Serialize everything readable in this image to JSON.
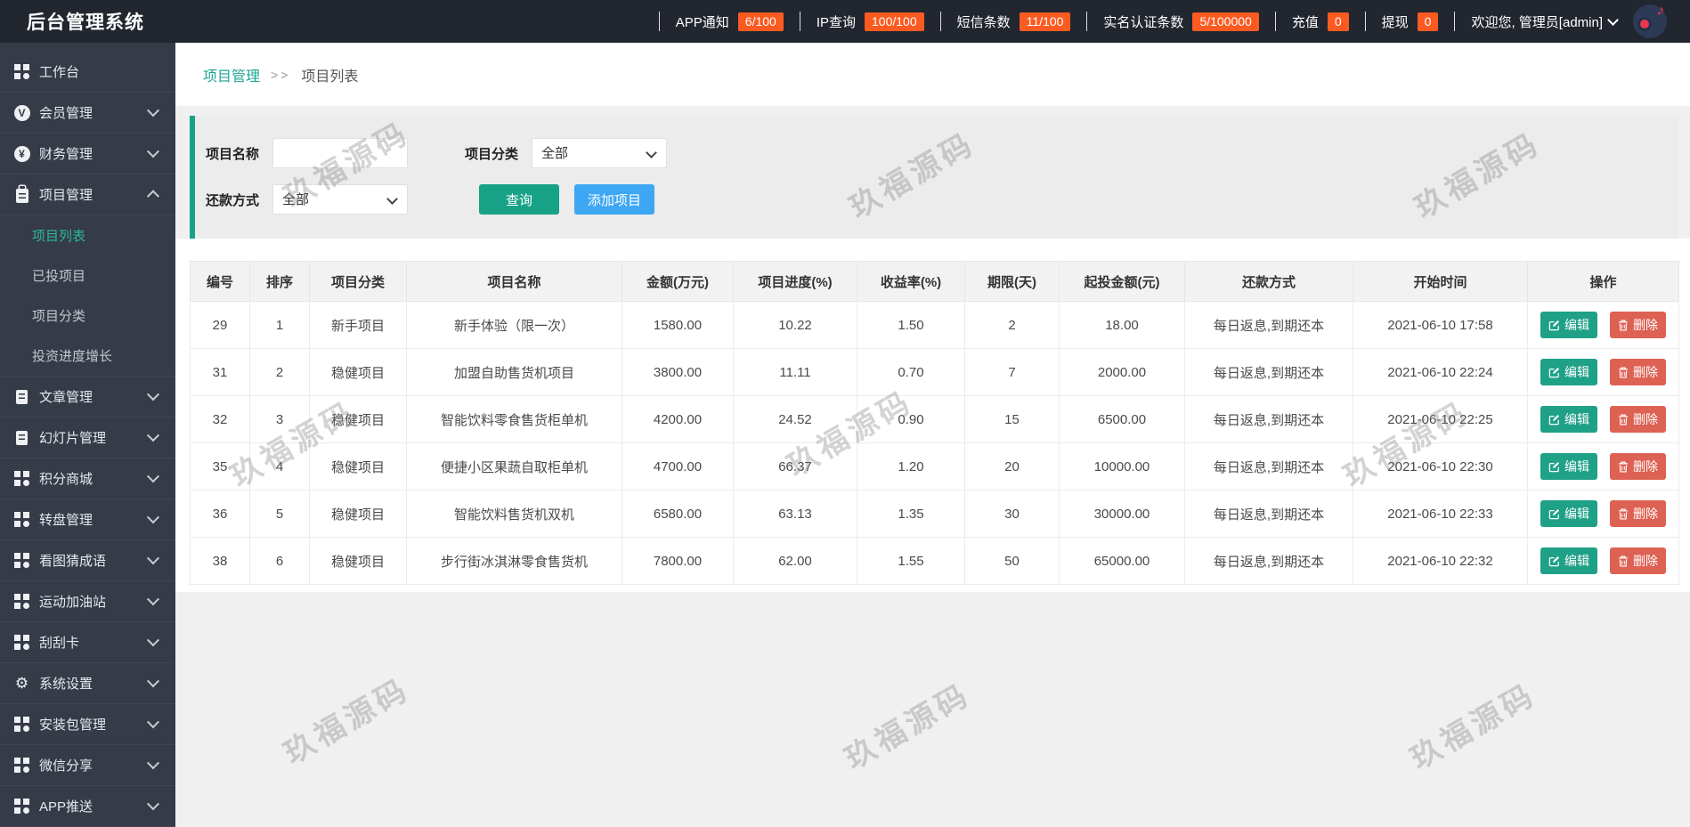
{
  "app": {
    "title": "后台管理系统"
  },
  "topbar": {
    "stats": [
      {
        "label": "APP通知",
        "badge": "6/100"
      },
      {
        "label": "IP查询",
        "badge": "100/100"
      },
      {
        "label": "短信条数",
        "badge": "11/100"
      },
      {
        "label": "实名认证条数",
        "badge": "5/100000"
      },
      {
        "label": "充值",
        "badge": "0"
      },
      {
        "label": "提现",
        "badge": "0"
      }
    ],
    "welcome_text": "欢迎您, 管理员[admin]",
    "badge_color": "#fb5b21"
  },
  "sidebar": {
    "items": [
      {
        "label": "工作台",
        "icon": "grid-icon",
        "chevron": "none"
      },
      {
        "label": "会员管理",
        "icon": "member-v-icon",
        "chevron": "down"
      },
      {
        "label": "财务管理",
        "icon": "finance-yen-icon",
        "chevron": "down"
      },
      {
        "label": "项目管理",
        "icon": "clipboard-icon",
        "chevron": "up",
        "expanded": true,
        "children": [
          {
            "label": "项目列表",
            "active": true
          },
          {
            "label": "已投项目",
            "active": false
          },
          {
            "label": "项目分类",
            "active": false
          },
          {
            "label": "投资进度增长",
            "active": false
          }
        ]
      },
      {
        "label": "文章管理",
        "icon": "article-icon",
        "chevron": "down"
      },
      {
        "label": "幻灯片管理",
        "icon": "slides-icon",
        "chevron": "down"
      },
      {
        "label": "积分商城",
        "icon": "grid-icon",
        "chevron": "down"
      },
      {
        "label": "转盘管理",
        "icon": "grid-icon",
        "chevron": "down"
      },
      {
        "label": "看图猜成语",
        "icon": "grid-icon",
        "chevron": "down"
      },
      {
        "label": "运动加油站",
        "icon": "grid-icon",
        "chevron": "down"
      },
      {
        "label": "刮刮卡",
        "icon": "grid-icon",
        "chevron": "down"
      },
      {
        "label": "系统设置",
        "icon": "gear-icon",
        "chevron": "down"
      },
      {
        "label": "安装包管理",
        "icon": "grid-icon",
        "chevron": "down"
      },
      {
        "label": "微信分享",
        "icon": "grid-icon",
        "chevron": "down"
      },
      {
        "label": "APP推送",
        "icon": "grid-icon",
        "chevron": "down"
      }
    ],
    "active_color": "#2cb79e"
  },
  "breadcrumb": {
    "section": "项目管理",
    "separator": ">>",
    "page": "项目列表"
  },
  "filter": {
    "name_label": "项目名称",
    "name_value": "",
    "category_label": "项目分类",
    "category_value": "全部",
    "repay_label": "还款方式",
    "repay_value": "全部",
    "search_button": "查询",
    "add_button": "添加项目"
  },
  "table": {
    "headers": [
      "编号",
      "排序",
      "项目分类",
      "项目名称",
      "金额(万元)",
      "项目进度(%)",
      "收益率(%)",
      "期限(天)",
      "起投金额(元)",
      "还款方式",
      "开始时间",
      "操作"
    ],
    "rows": [
      {
        "id": "29",
        "order": "1",
        "category": "新手项目",
        "name": "新手体验（限一次）",
        "amount": "1580.00",
        "progress": "10.22",
        "rate": "1.50",
        "days": "2",
        "min_invest": "18.00",
        "repay": "每日返息,到期还本",
        "start": "2021-06-10 17:58"
      },
      {
        "id": "31",
        "order": "2",
        "category": "稳健项目",
        "name": "加盟自助售货机项目",
        "amount": "3800.00",
        "progress": "11.11",
        "rate": "0.70",
        "days": "7",
        "min_invest": "2000.00",
        "repay": "每日返息,到期还本",
        "start": "2021-06-10 22:24"
      },
      {
        "id": "32",
        "order": "3",
        "category": "稳健项目",
        "name": "智能饮料零食售货柜单机",
        "amount": "4200.00",
        "progress": "24.52",
        "rate": "0.90",
        "days": "15",
        "min_invest": "6500.00",
        "repay": "每日返息,到期还本",
        "start": "2021-06-10 22:25"
      },
      {
        "id": "35",
        "order": "4",
        "category": "稳健项目",
        "name": "便捷小区果蔬自取柜单机",
        "amount": "4700.00",
        "progress": "66.37",
        "rate": "1.20",
        "days": "20",
        "min_invest": "10000.00",
        "repay": "每日返息,到期还本",
        "start": "2021-06-10 22:30"
      },
      {
        "id": "36",
        "order": "5",
        "category": "稳健项目",
        "name": "智能饮料售货机双机",
        "amount": "6580.00",
        "progress": "63.13",
        "rate": "1.35",
        "days": "30",
        "min_invest": "30000.00",
        "repay": "每日返息,到期还本",
        "start": "2021-06-10 22:33"
      },
      {
        "id": "38",
        "order": "6",
        "category": "稳健项目",
        "name": "步行街冰淇淋零食售货机",
        "amount": "7800.00",
        "progress": "62.00",
        "rate": "1.55",
        "days": "50",
        "min_invest": "65000.00",
        "repay": "每日返息,到期还本",
        "start": "2021-06-10 22:32"
      }
    ],
    "edit_label": "编辑",
    "delete_label": "删除"
  },
  "watermark": {
    "text": "玖福源码"
  },
  "colors": {
    "accent_teal": "#17a287",
    "accent_blue": "#3ea7f4",
    "badge_orange": "#fb5b21",
    "edit_green": "#1fa187",
    "delete_red": "#dd6254",
    "active_menu": "#2cb79e"
  }
}
